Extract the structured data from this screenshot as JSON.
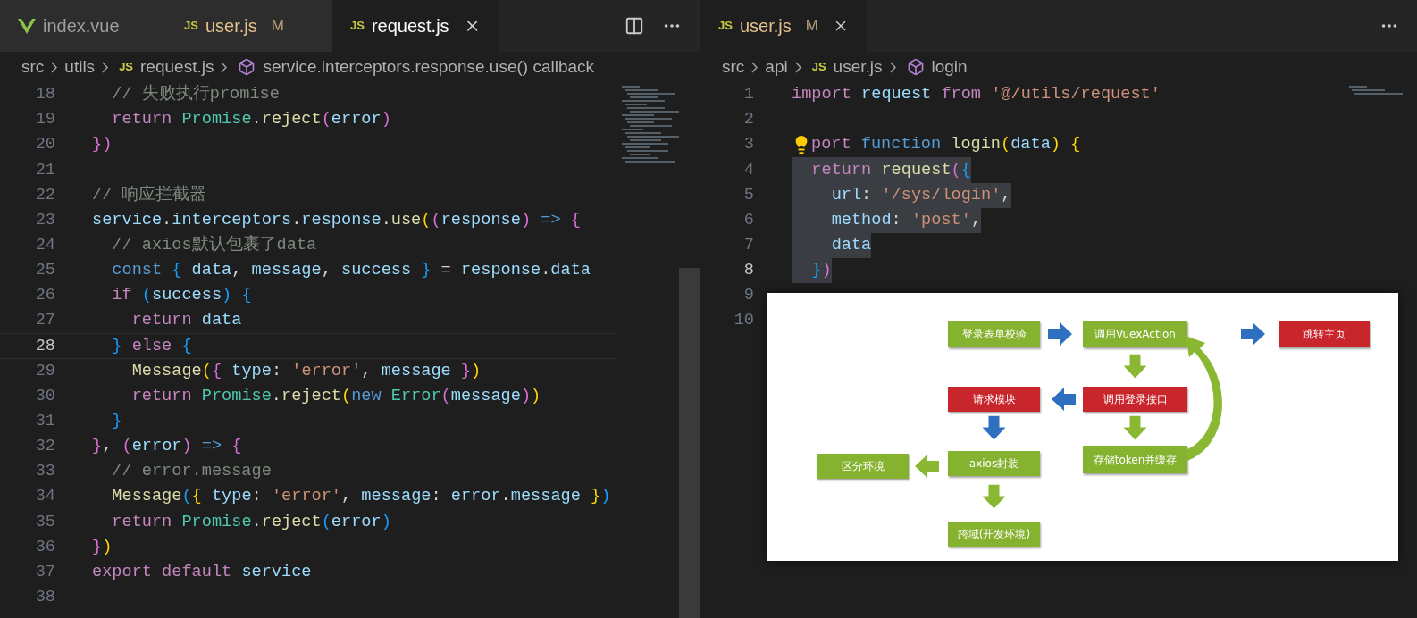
{
  "left_editor": {
    "tabs": [
      {
        "kind": "vue",
        "label": "index.vue",
        "selected": false
      },
      {
        "kind": "js",
        "icon_text": "JS",
        "label": "user.js",
        "badge": "M",
        "selected": false
      },
      {
        "kind": "js",
        "icon_text": "JS",
        "label": "request.js",
        "selected": true
      }
    ],
    "breadcrumbs": [
      {
        "kind": "folder",
        "text": "src"
      },
      {
        "kind": "folder",
        "text": "utils"
      },
      {
        "kind": "file",
        "icon_text": "JS",
        "text": "request.js"
      },
      {
        "kind": "symbol",
        "text": "service.interceptors.response.use() callback"
      }
    ],
    "lines": [
      {
        "number": "18",
        "current": false,
        "tokens": [
          {
            "kind": "comment",
            "text": "  // 失败执行promise"
          }
        ]
      },
      {
        "number": "19",
        "current": false,
        "tokens": [
          {
            "kind": "control",
            "text": "  return "
          },
          {
            "kind": "class",
            "text": "Promise"
          },
          {
            "kind": "plain",
            "text": "."
          },
          {
            "kind": "function",
            "text": "reject"
          },
          {
            "kind": "bracket2",
            "text": "("
          },
          {
            "kind": "variable",
            "text": "error"
          },
          {
            "kind": "bracket2",
            "text": ")"
          }
        ]
      },
      {
        "number": "20",
        "current": false,
        "tokens": [
          {
            "kind": "bracket2",
            "text": "})"
          }
        ]
      },
      {
        "number": "21",
        "current": false
      },
      {
        "number": "22",
        "current": false,
        "tokens": [
          {
            "kind": "comment",
            "text": "// 响应拦截器"
          }
        ]
      },
      {
        "number": "23",
        "current": false,
        "tokens": [
          {
            "kind": "variable",
            "text": "service"
          },
          {
            "kind": "plain",
            "text": "."
          },
          {
            "kind": "variable",
            "text": "interceptors"
          },
          {
            "kind": "plain",
            "text": "."
          },
          {
            "kind": "variable",
            "text": "response"
          },
          {
            "kind": "plain",
            "text": "."
          },
          {
            "kind": "function",
            "text": "use"
          },
          {
            "kind": "bracket1",
            "text": "("
          },
          {
            "kind": "bracket2",
            "text": "("
          },
          {
            "kind": "variable",
            "text": "response"
          },
          {
            "kind": "bracket2",
            "text": ")"
          },
          {
            "kind": "keyword",
            "text": " => "
          },
          {
            "kind": "bracket2",
            "text": "{"
          }
        ]
      },
      {
        "number": "24",
        "current": false,
        "tokens": [
          {
            "kind": "comment",
            "text": "  // axios默认包裹了data"
          }
        ]
      },
      {
        "number": "25",
        "current": false,
        "tokens": [
          {
            "kind": "keyword",
            "text": "  const "
          },
          {
            "kind": "bracket3",
            "text": "{ "
          },
          {
            "kind": "variable",
            "text": "data"
          },
          {
            "kind": "plain",
            "text": ", "
          },
          {
            "kind": "variable",
            "text": "message"
          },
          {
            "kind": "plain",
            "text": ", "
          },
          {
            "kind": "variable",
            "text": "success "
          },
          {
            "kind": "bracket3",
            "text": "}"
          },
          {
            "kind": "plain",
            "text": " = "
          },
          {
            "kind": "variable",
            "text": "response"
          },
          {
            "kind": "plain",
            "text": "."
          },
          {
            "kind": "variable",
            "text": "data"
          }
        ]
      },
      {
        "number": "26",
        "current": false,
        "tokens": [
          {
            "kind": "control",
            "text": "  if "
          },
          {
            "kind": "bracket3",
            "text": "("
          },
          {
            "kind": "variable",
            "text": "success"
          },
          {
            "kind": "bracket3",
            "text": ") {"
          }
        ]
      },
      {
        "number": "27",
        "current": false,
        "tokens": [
          {
            "kind": "control",
            "text": "    return "
          },
          {
            "kind": "variable",
            "text": "data"
          }
        ]
      },
      {
        "number": "28",
        "current": true,
        "tokens": [
          {
            "kind": "bracket3",
            "text": "  } "
          },
          {
            "kind": "control",
            "text": "else "
          },
          {
            "kind": "bracket3",
            "text": "{"
          }
        ]
      },
      {
        "number": "29",
        "current": false,
        "tokens": [
          {
            "kind": "function",
            "text": "    Message"
          },
          {
            "kind": "bracket1",
            "text": "("
          },
          {
            "kind": "bracket2",
            "text": "{ "
          },
          {
            "kind": "variable",
            "text": "type"
          },
          {
            "kind": "plain",
            "text": ": "
          },
          {
            "kind": "string",
            "text": "'error'"
          },
          {
            "kind": "plain",
            "text": ", "
          },
          {
            "kind": "variable",
            "text": "message "
          },
          {
            "kind": "bracket2",
            "text": "}"
          },
          {
            "kind": "bracket1",
            "text": ")"
          }
        ]
      },
      {
        "number": "30",
        "current": false,
        "tokens": [
          {
            "kind": "control",
            "text": "    return "
          },
          {
            "kind": "class",
            "text": "Promise"
          },
          {
            "kind": "plain",
            "text": "."
          },
          {
            "kind": "function",
            "text": "reject"
          },
          {
            "kind": "bracket1",
            "text": "("
          },
          {
            "kind": "keyword",
            "text": "new "
          },
          {
            "kind": "class",
            "text": "Error"
          },
          {
            "kind": "bracket2",
            "text": "("
          },
          {
            "kind": "variable",
            "text": "message"
          },
          {
            "kind": "bracket2",
            "text": ")"
          },
          {
            "kind": "bracket1",
            "text": ")"
          }
        ]
      },
      {
        "number": "31",
        "current": false,
        "tokens": [
          {
            "kind": "bracket3",
            "text": "  }"
          }
        ]
      },
      {
        "number": "32",
        "current": false,
        "tokens": [
          {
            "kind": "bracket2",
            "text": "}"
          },
          {
            "kind": "plain",
            "text": ", "
          },
          {
            "kind": "bracket2",
            "text": "("
          },
          {
            "kind": "variable",
            "text": "error"
          },
          {
            "kind": "bracket2",
            "text": ")"
          },
          {
            "kind": "keyword",
            "text": " => "
          },
          {
            "kind": "bracket2",
            "text": "{"
          }
        ]
      },
      {
        "number": "33",
        "current": false,
        "tokens": [
          {
            "kind": "comment",
            "text": "  // error.message"
          }
        ]
      },
      {
        "number": "34",
        "current": false,
        "tokens": [
          {
            "kind": "function",
            "text": "  Message"
          },
          {
            "kind": "bracket3",
            "text": "("
          },
          {
            "kind": "bracket1",
            "text": "{ "
          },
          {
            "kind": "variable",
            "text": "type"
          },
          {
            "kind": "plain",
            "text": ": "
          },
          {
            "kind": "string",
            "text": "'error'"
          },
          {
            "kind": "plain",
            "text": ", "
          },
          {
            "kind": "variable",
            "text": "message"
          },
          {
            "kind": "plain",
            "text": ": "
          },
          {
            "kind": "variable",
            "text": "error"
          },
          {
            "kind": "plain",
            "text": "."
          },
          {
            "kind": "variable",
            "text": "message "
          },
          {
            "kind": "bracket1",
            "text": "}"
          },
          {
            "kind": "bracket3",
            "text": ")"
          }
        ]
      },
      {
        "number": "35",
        "current": false,
        "tokens": [
          {
            "kind": "control",
            "text": "  return "
          },
          {
            "kind": "class",
            "text": "Promise"
          },
          {
            "kind": "plain",
            "text": "."
          },
          {
            "kind": "function",
            "text": "reject"
          },
          {
            "kind": "bracket3",
            "text": "("
          },
          {
            "kind": "variable",
            "text": "error"
          },
          {
            "kind": "bracket3",
            "text": ")"
          }
        ]
      },
      {
        "number": "36",
        "current": false,
        "tokens": [
          {
            "kind": "bracket2",
            "text": "}"
          },
          {
            "kind": "bracket1",
            "text": ")"
          }
        ]
      },
      {
        "number": "37",
        "current": false,
        "tokens": [
          {
            "kind": "control",
            "text": "export default "
          },
          {
            "kind": "variable",
            "text": "service"
          }
        ]
      },
      {
        "number": "38",
        "current": false
      }
    ]
  },
  "right_editor": {
    "tabs": [
      {
        "kind": "js",
        "icon_text": "JS",
        "label": "user.js",
        "badge": "M",
        "selected": true
      }
    ],
    "breadcrumbs": [
      {
        "kind": "folder",
        "text": "src"
      },
      {
        "kind": "folder",
        "text": "api"
      },
      {
        "kind": "file",
        "icon_text": "JS",
        "text": "user.js"
      },
      {
        "kind": "symbol",
        "text": "login"
      }
    ],
    "lines": [
      {
        "number": "1",
        "current": false,
        "highlighted": false,
        "lightbulb": false,
        "tokens": [
          {
            "kind": "control",
            "text": "import "
          },
          {
            "kind": "variable",
            "text": "request "
          },
          {
            "kind": "control",
            "text": "from "
          },
          {
            "kind": "string",
            "text": "'@/utils/request'"
          }
        ]
      },
      {
        "number": "2",
        "current": false,
        "lightbulb": false
      },
      {
        "number": "3",
        "current": false,
        "highlighted": false,
        "lightbulb": true,
        "tokens": [
          {
            "kind": "control",
            "text": "port "
          },
          {
            "kind": "keyword",
            "text": "function "
          },
          {
            "kind": "function",
            "text": "login"
          },
          {
            "kind": "bracket1",
            "text": "("
          },
          {
            "kind": "variable",
            "text": "data"
          },
          {
            "kind": "bracket1",
            "text": ") {"
          }
        ]
      },
      {
        "number": "4",
        "current": false,
        "highlighted": true,
        "lightbulb": false,
        "tokens": [
          {
            "kind": "control",
            "text": "  return "
          },
          {
            "kind": "function",
            "text": "request"
          },
          {
            "kind": "bracket2",
            "text": "("
          },
          {
            "kind": "bracket3",
            "text": "{"
          }
        ]
      },
      {
        "number": "5",
        "current": false,
        "highlighted": true,
        "lightbulb": false,
        "tokens": [
          {
            "kind": "variable",
            "text": "    url"
          },
          {
            "kind": "plain",
            "text": ": "
          },
          {
            "kind": "string",
            "text": "'/sys/login'"
          },
          {
            "kind": "plain",
            "text": ","
          }
        ]
      },
      {
        "number": "6",
        "current": false,
        "highlighted": true,
        "lightbulb": false,
        "tokens": [
          {
            "kind": "variable",
            "text": "    method"
          },
          {
            "kind": "plain",
            "text": ": "
          },
          {
            "kind": "string",
            "text": "'post'"
          },
          {
            "kind": "plain",
            "text": ","
          }
        ]
      },
      {
        "number": "7",
        "current": false,
        "highlighted": true,
        "lightbulb": false,
        "tokens": [
          {
            "kind": "variable",
            "text": "    data"
          }
        ]
      },
      {
        "number": "8",
        "current": true,
        "highlighted": true,
        "lightbulb": false,
        "tokens": [
          {
            "kind": "bracket3",
            "text": "  }"
          },
          {
            "kind": "bracket2",
            "text": ")"
          }
        ]
      },
      {
        "number": "9",
        "current": false,
        "lightbulb": false
      },
      {
        "number": "10",
        "current": false,
        "lightbulb": false
      }
    ]
  },
  "flow_diagram": {
    "nodes": [
      {
        "label": "登录表单校验",
        "color": "#85b22f"
      },
      {
        "label": "调用VuexAction",
        "color": "#85b22f"
      },
      {
        "label": "跳转主页",
        "color": "#c8262c"
      },
      {
        "label": "请求模块",
        "color": "#c8262c"
      },
      {
        "label": "调用登录接口",
        "color": "#c8262c"
      },
      {
        "label": "存储token并缓存",
        "color": "#85b22f"
      },
      {
        "label": "区分环境",
        "color": "#85b22f"
      },
      {
        "label": "axios封装",
        "color": "#85b22f"
      },
      {
        "label": "跨域(开发环境)",
        "color": "#85b22f"
      }
    ]
  }
}
